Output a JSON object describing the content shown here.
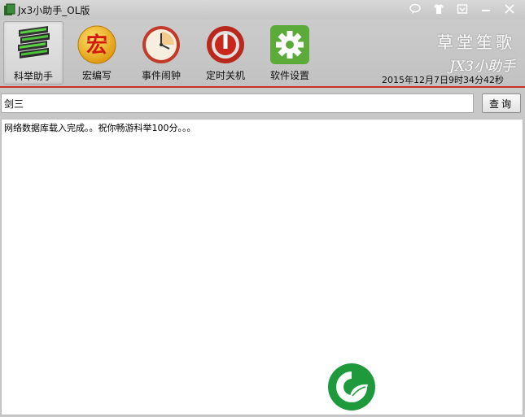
{
  "window": {
    "title": "Jx3小助手_OL版",
    "title_buttons": [
      "chat-icon",
      "shirt-icon",
      "menu-icon",
      "minimize-icon",
      "close-icon"
    ]
  },
  "toolbar": {
    "items": [
      {
        "label": "科举助手",
        "icon": "books-icon",
        "active": true
      },
      {
        "label": "宏编写",
        "icon": "macro-icon",
        "active": false
      },
      {
        "label": "事件闹钟",
        "icon": "clock-icon",
        "active": false
      },
      {
        "label": "定时关机",
        "icon": "power-icon",
        "active": false
      },
      {
        "label": "软件设置",
        "icon": "gear-icon",
        "active": false
      }
    ],
    "brand_line1": "草堂笙歌",
    "brand_line2": "JX3小助手",
    "datetime": "2015年12月7日9时34分42秒",
    "macro_glyph": "宏"
  },
  "search": {
    "value": "剑三",
    "button_label": "查询"
  },
  "log": {
    "text": "网络数据库载入完成。。祝你畅游科举100分。。。"
  },
  "colors": {
    "accent_red": "#c8322a",
    "window_gray": "#c8c8c8",
    "logo_green": "#1e9a3c"
  }
}
